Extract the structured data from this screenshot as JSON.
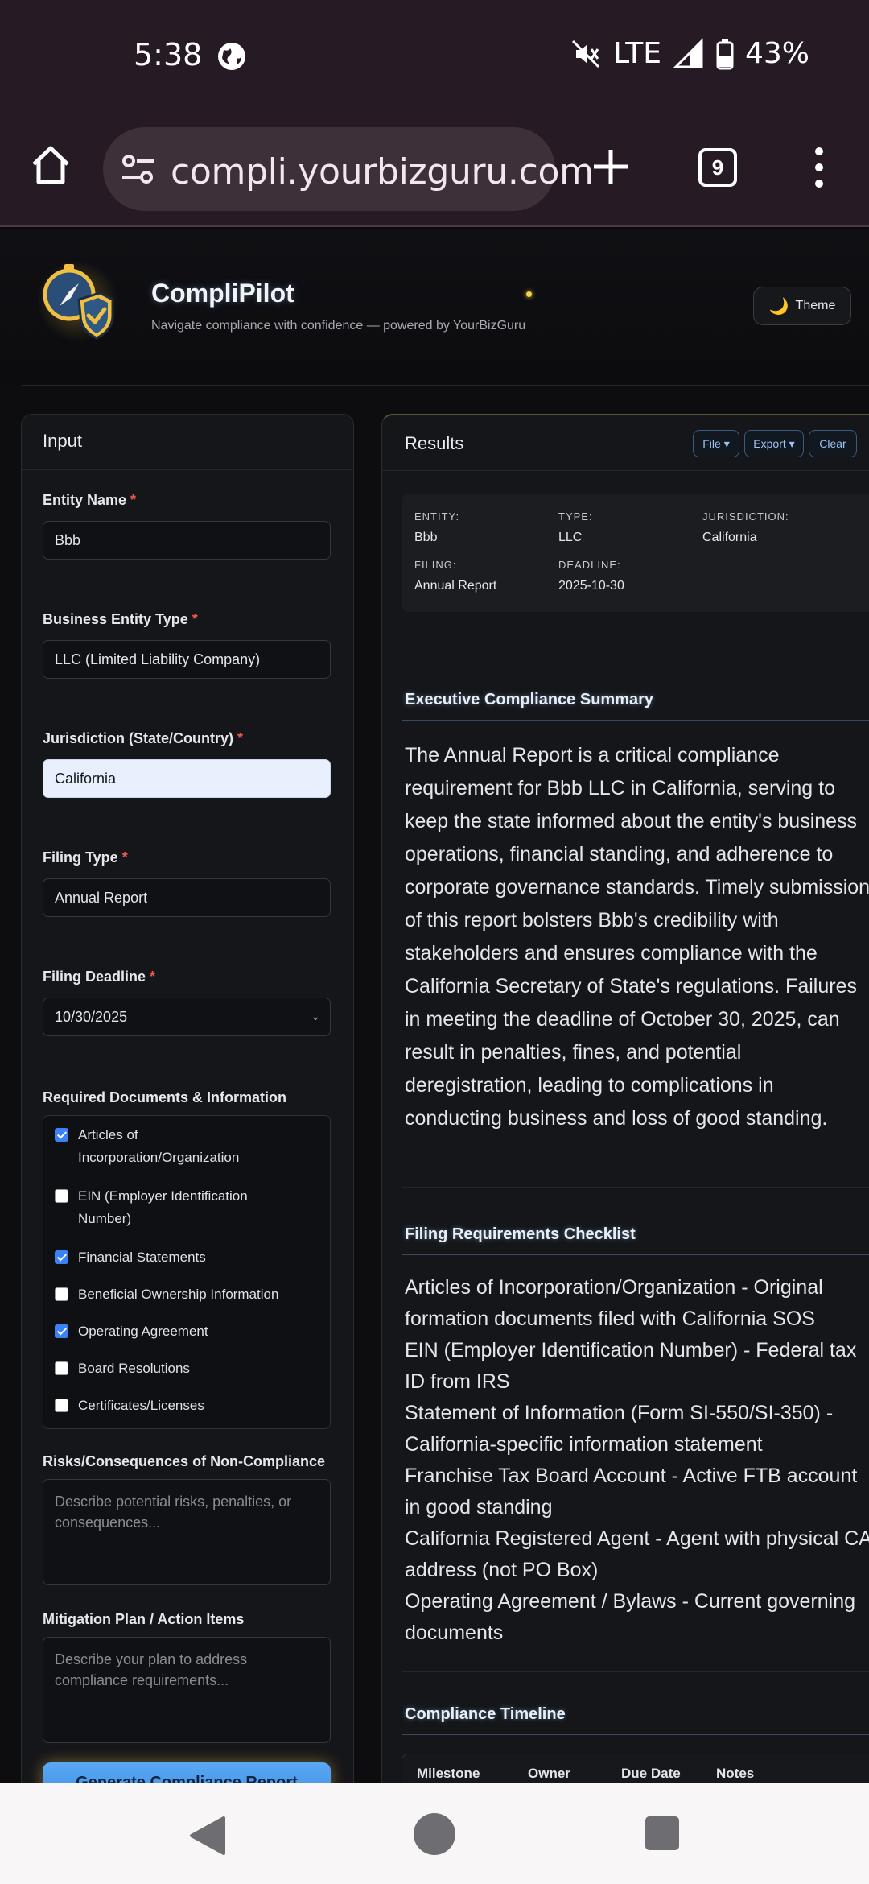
{
  "status_bar": {
    "time": "5:38",
    "network": "LTE",
    "battery": "43%"
  },
  "browser": {
    "url": "compli.yourbizguru.com",
    "tab_count": "9"
  },
  "app": {
    "name": "CompliPilot",
    "tagline": "Navigate compliance with confidence — powered by YourBizGuru",
    "theme_label": "Theme"
  },
  "input_panel": {
    "title": "Input",
    "entity_name": {
      "label": "Entity Name",
      "value": "Bbb"
    },
    "entity_type": {
      "label": "Business Entity Type",
      "value": "LLC (Limited Liability Company)"
    },
    "jurisdiction": {
      "label": "Jurisdiction (State/Country)",
      "value": "California"
    },
    "filing_type": {
      "label": "Filing Type",
      "value": "Annual Report"
    },
    "filing_deadline": {
      "label": "Filing Deadline",
      "value": "10/30/2025"
    },
    "required_marker": "*",
    "documents": {
      "label": "Required Documents & Information",
      "items": [
        {
          "label": "Articles of Incorporation/Organization",
          "checked": true
        },
        {
          "label": "EIN (Employer Identification Number)",
          "checked": false
        },
        {
          "label": "Financial Statements",
          "checked": true
        },
        {
          "label": "Beneficial Ownership Information",
          "checked": false
        },
        {
          "label": "Operating Agreement",
          "checked": true
        },
        {
          "label": "Board Resolutions",
          "checked": false
        },
        {
          "label": "Certificates/Licenses",
          "checked": false
        }
      ]
    },
    "risks": {
      "label": "Risks/Consequences of Non-Compliance",
      "placeholder": "Describe potential risks, penalties, or consequences..."
    },
    "mitigation": {
      "label": "Mitigation Plan / Action Items",
      "placeholder": "Describe your plan to address compliance requirements..."
    },
    "generate_label": "Generate Compliance Report"
  },
  "results_panel": {
    "title": "Results",
    "buttons": {
      "file": "File ▾",
      "export": "Export ▾",
      "clear": "Clear"
    },
    "meta": {
      "entity": {
        "key": "ENTITY:",
        "value": "Bbb"
      },
      "type": {
        "key": "TYPE:",
        "value": "LLC"
      },
      "jurisdiction": {
        "key": "JURISDICTION:",
        "value": "California"
      },
      "filing": {
        "key": "FILING:",
        "value": "Annual Report"
      },
      "deadline": {
        "key": "DEADLINE:",
        "value": "2025-10-30"
      }
    },
    "summary": {
      "title": "Executive Compliance Summary",
      "text": "The Annual Report is a critical compliance requirement for Bbb LLC in California, serving to keep the state informed about the entity's business operations, financial standing, and adherence to corporate governance standards. Timely submission of this report bolsters Bbb's credibility with stakeholders and ensures compliance with the California Secretary of State's regulations. Failures in meeting the deadline of October 30, 2025, can result in penalties, fines, and potential deregistration, leading to complications in conducting business and loss of good standing."
    },
    "checklist": {
      "title": "Filing Requirements Checklist",
      "items": [
        "Articles of Incorporation/Organization - Original formation documents filed with California SOS",
        "EIN (Employer Identification Number) - Federal tax ID from IRS",
        "Statement of Information (Form SI-550/SI-350) - California-specific information statement",
        "Franchise Tax Board Account - Active FTB account in good standing",
        "California Registered Agent - Agent with physical CA address (not PO Box)",
        "Operating Agreement / Bylaws - Current governing documents"
      ]
    },
    "timeline": {
      "title": "Compliance Timeline",
      "columns": [
        "Milestone",
        "Owner",
        "Due Date",
        "Notes"
      ]
    }
  }
}
